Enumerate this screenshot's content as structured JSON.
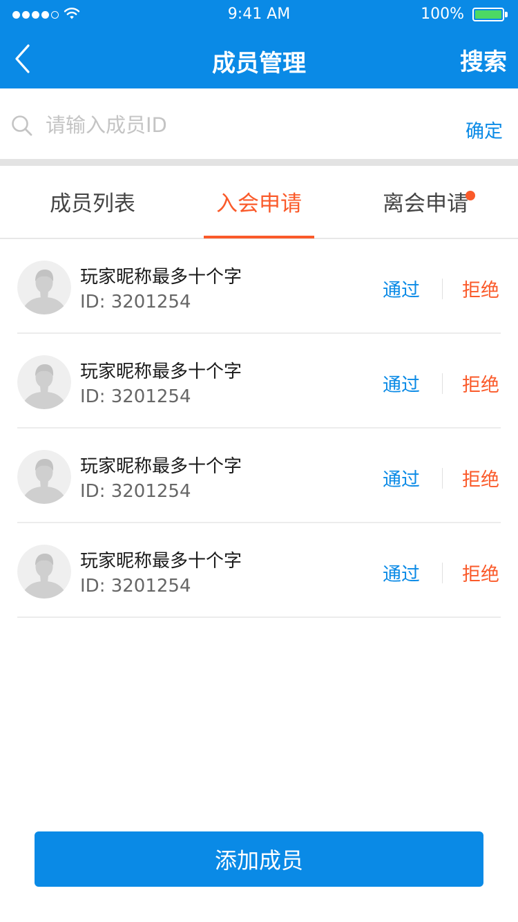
{
  "status_bar": {
    "time": "9:41 AM",
    "battery_percent": "100%",
    "signal_bars_filled": 4,
    "signal_bars_total": 5
  },
  "nav": {
    "title": "成员管理",
    "search_label": "搜索",
    "back_icon": "chevron-left-icon"
  },
  "search": {
    "value": "",
    "placeholder": "请输入成员ID",
    "confirm_label": "确定"
  },
  "tabs": [
    {
      "label": "成员列表",
      "active": false,
      "has_badge": false
    },
    {
      "label": "入会申请",
      "active": true,
      "has_badge": false
    },
    {
      "label": "离会申请",
      "active": false,
      "has_badge": true
    }
  ],
  "members": [
    {
      "name": "玩家昵称最多十个字",
      "id": "ID: 3201254",
      "approve_label": "通过",
      "reject_label": "拒绝"
    },
    {
      "name": "玩家昵称最多十个字",
      "id": "ID: 3201254",
      "approve_label": "通过",
      "reject_label": "拒绝"
    },
    {
      "name": "玩家昵称最多十个字",
      "id": "ID: 3201254",
      "approve_label": "通过",
      "reject_label": "拒绝"
    },
    {
      "name": "玩家昵称最多十个字",
      "id": "ID: 3201254",
      "approve_label": "通过",
      "reject_label": "拒绝"
    }
  ],
  "add_button_label": "添加成员",
  "colors": {
    "primary": "#0a8ae6",
    "accent": "#fa5a2a",
    "battery": "#4cd964"
  }
}
